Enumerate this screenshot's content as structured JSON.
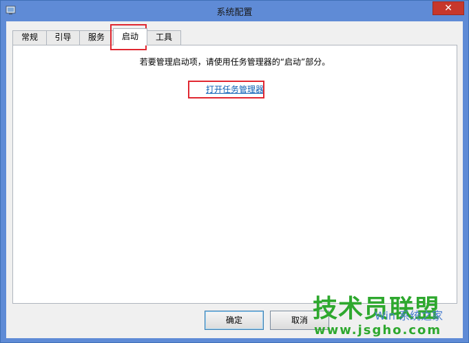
{
  "window": {
    "title": "系统配置",
    "close_glyph": "✕"
  },
  "tabs": [
    {
      "label": "常规",
      "active": false
    },
    {
      "label": "引导",
      "active": false
    },
    {
      "label": "服务",
      "active": false
    },
    {
      "label": "启动",
      "active": true
    },
    {
      "label": "工具",
      "active": false
    }
  ],
  "panel": {
    "message": "若要管理启动项，请使用任务管理器的“启动”部分。",
    "link_label": "打开任务管理器"
  },
  "buttons": {
    "ok": "确定",
    "cancel": "取消"
  },
  "watermark": {
    "main": "技术员联盟",
    "url": "www.jsgho.com",
    "side": "Win 系统之家"
  },
  "colors": {
    "highlight_box": "#e0262f",
    "link": "#0b5fb5",
    "titlebar": "#5f8bd6"
  }
}
